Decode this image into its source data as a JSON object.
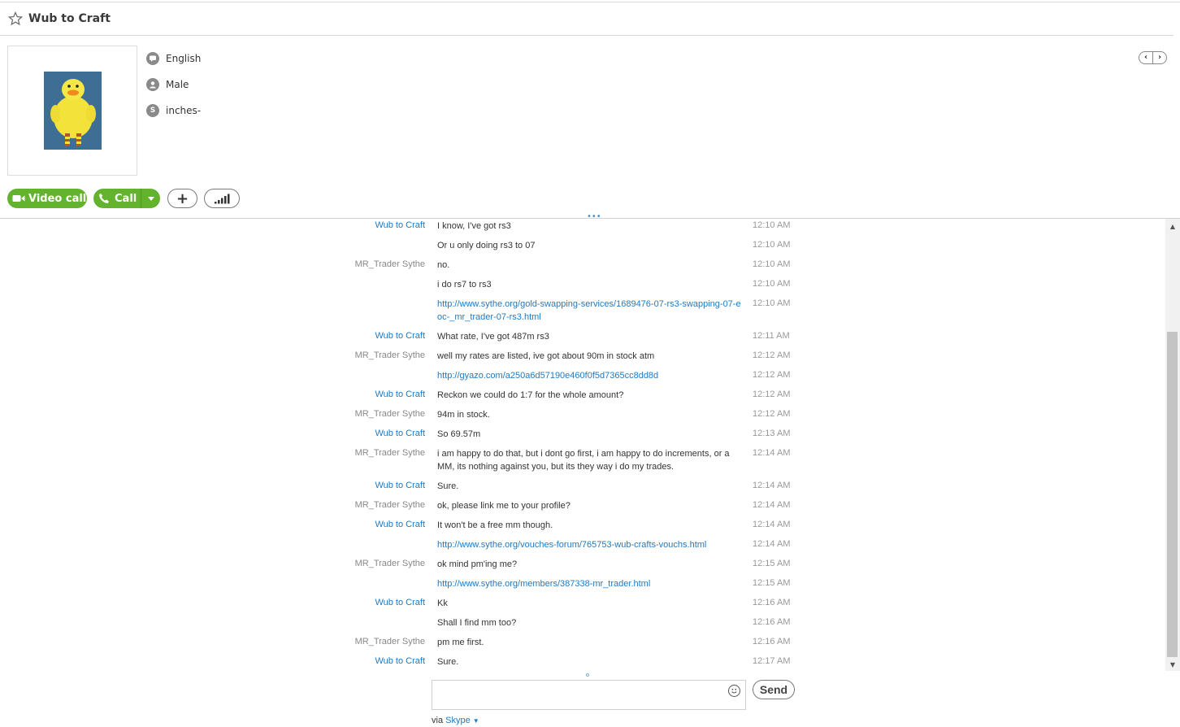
{
  "header": {
    "title": "Wub to Craft",
    "star_icon": "star-icon"
  },
  "profile": {
    "language": "English",
    "gender": "Male",
    "skype_name": "inches-"
  },
  "actions": {
    "video_call_label": "Video call",
    "call_label": "Call",
    "add_label": "+"
  },
  "messages": [
    {
      "sender": "Wub to Craft",
      "mine": true,
      "text": "I know, I've got rs3",
      "link": false,
      "time": "12:10 AM"
    },
    {
      "sender": "",
      "mine": true,
      "text": "Or u only doing rs3 to 07",
      "link": false,
      "time": "12:10 AM"
    },
    {
      "sender": "MR_Trader Sythe",
      "mine": false,
      "text": "no.",
      "link": false,
      "time": "12:10 AM"
    },
    {
      "sender": "",
      "mine": false,
      "text": "i do rs7 to rs3",
      "link": false,
      "time": "12:10 AM"
    },
    {
      "sender": "",
      "mine": false,
      "text": "http://www.sythe.org/gold-swapping-services/1689476-07-rs3-swapping-07-eoc-_mr_trader-07-rs3.html",
      "link": true,
      "time": "12:10 AM"
    },
    {
      "sender": "Wub to Craft",
      "mine": true,
      "text": "What rate, I've got 487m rs3",
      "link": false,
      "time": "12:11 AM"
    },
    {
      "sender": "MR_Trader Sythe",
      "mine": false,
      "text": "well my rates are listed, ive got about 90m in stock atm",
      "link": false,
      "time": "12:12 AM"
    },
    {
      "sender": "",
      "mine": false,
      "text": "http://gyazo.com/a250a6d57190e460f0f5d7365cc8dd8d",
      "link": true,
      "time": "12:12 AM"
    },
    {
      "sender": "Wub to Craft",
      "mine": true,
      "text": "Reckon we could do 1:7 for the whole amount?",
      "link": false,
      "time": "12:12 AM"
    },
    {
      "sender": "MR_Trader Sythe",
      "mine": false,
      "text": "94m in stock.",
      "link": false,
      "time": "12:12 AM"
    },
    {
      "sender": "Wub to Craft",
      "mine": true,
      "text": "So 69.57m",
      "link": false,
      "time": "12:13 AM"
    },
    {
      "sender": "MR_Trader Sythe",
      "mine": false,
      "text": "i am happy to do that, but i dont go first, i am happy to do increments, or a MM, its nothing against you, but its they way i do my trades.",
      "link": false,
      "time": "12:14 AM"
    },
    {
      "sender": "Wub to Craft",
      "mine": true,
      "text": "Sure.",
      "link": false,
      "time": "12:14 AM"
    },
    {
      "sender": "MR_Trader Sythe",
      "mine": false,
      "text": "ok, please link me to your profile?",
      "link": false,
      "time": "12:14 AM"
    },
    {
      "sender": "Wub to Craft",
      "mine": true,
      "text": "It won't be a free mm though.",
      "link": false,
      "time": "12:14 AM"
    },
    {
      "sender": "",
      "mine": true,
      "text": "http://www.sythe.org/vouches-forum/765753-wub-crafts-vouchs.html",
      "link": true,
      "time": "12:14 AM"
    },
    {
      "sender": "MR_Trader Sythe",
      "mine": false,
      "text": "ok mind pm'ing me?",
      "link": false,
      "time": "12:15 AM"
    },
    {
      "sender": "",
      "mine": false,
      "text": "http://www.sythe.org/members/387338-mr_trader.html",
      "link": true,
      "time": "12:15 AM"
    },
    {
      "sender": "Wub to Craft",
      "mine": true,
      "text": "Kk",
      "link": false,
      "time": "12:16 AM"
    },
    {
      "sender": "",
      "mine": true,
      "text": "Shall I find mm too?",
      "link": false,
      "time": "12:16 AM"
    },
    {
      "sender": "MR_Trader Sythe",
      "mine": false,
      "text": "pm me first.",
      "link": false,
      "time": "12:16 AM"
    },
    {
      "sender": "Wub to Craft",
      "mine": true,
      "text": "Sure.",
      "link": false,
      "time": "12:17 AM"
    }
  ],
  "composer": {
    "placeholder": "",
    "send_label": "Send",
    "via_label": "via",
    "via_service": "Skype"
  },
  "colors": {
    "accent_green": "#63b32e",
    "link_blue": "#1e7ac4"
  }
}
